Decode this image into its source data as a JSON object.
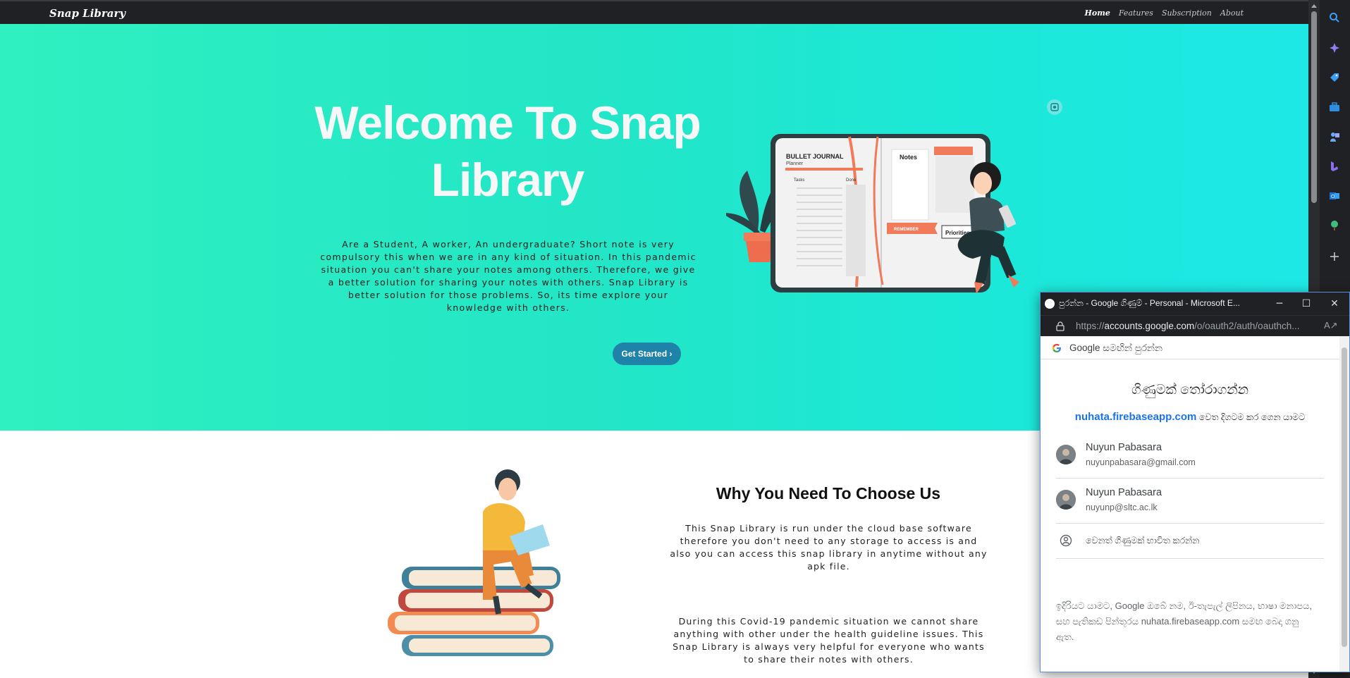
{
  "site": {
    "brand": "Snap Library",
    "nav": [
      "Home",
      "Features",
      "Subscription",
      "About"
    ],
    "hero_title": "Welcome To Snap Library",
    "hero_text": "Are a Student, A worker, An undergraduate? Short note is very compulsory this when we are in any kind of situation. In this pandemic situation you can't share your notes among others. Therefore, we give a better solution for sharing your notes with others. Snap Library is better solution for those problems. So, its time explore your knowledge with others.",
    "cta_label": "Get Started",
    "cta_icon": "chevron-right-icon",
    "why_title": "Why You Need To Choose Us",
    "why_text_1": "This Snap Library is run under the cloud base software therefore you don't need to any storage to access is and also you can access this snap library in anytime without any apk file.",
    "why_text_2": "During this Covid-19 pandemic situation we cannot share anything with other under the health guideline issues. This Snap Library is always very helpful for everyone who wants to share their notes with others.",
    "illustration_text": {
      "journal_title": "BULLET JOURNAL",
      "journal_sub": "Planner",
      "tasks": "Tasks",
      "done": "Done",
      "notes": "Notes",
      "priorities": "Priorities",
      "remember": "REMEMBER"
    }
  },
  "popup": {
    "window_title": "පුරන්න - Google ගිණුම් - Personal - Microsoft E...",
    "url_prefix": "https://",
    "url_host": "accounts.google.com",
    "url_path": "/o/oauth2/auth/oauthch...",
    "signin_header": "Google සමඟින් පුරන්න",
    "choose_title": "ගිණුමක් තෝරාගන්න",
    "continue_link": "nuhata.firebaseapp.com",
    "continue_suffix": "වෙත දිගටම කර ගෙන යාමට",
    "accounts": [
      {
        "name": "Nuyun Pabasara",
        "email": "nuyunpabasara@gmail.com"
      },
      {
        "name": "Nuyun Pabasara",
        "email": "nuyunp@sltc.ac.lk"
      }
    ],
    "other_account": "වෙනත් ගිණුමක් භාවිත කරන්න",
    "privacy_note": "ඉදිරියට යාමට, Google ඔබේ නම, ඊ-තැපැල් ලිපිනය, භාෂා මනාපය, සහ පැතිකඩ පින්තූරය nuhata.firebaseapp.com සමඟ බෙදා ගනු ඇත."
  },
  "colors": {
    "hero_start": "#2ff0c0",
    "hero_end": "#1ee8e6",
    "cta": "#1f82a8",
    "link": "#1a73e8",
    "nav_bg": "#202124"
  },
  "sidebar_icons": [
    "search-icon",
    "copilot-icon",
    "shopping-tag-icon",
    "toolbox-icon",
    "games-icon",
    "bing-icon",
    "outlook-icon",
    "tree-icon",
    "add-icon"
  ]
}
